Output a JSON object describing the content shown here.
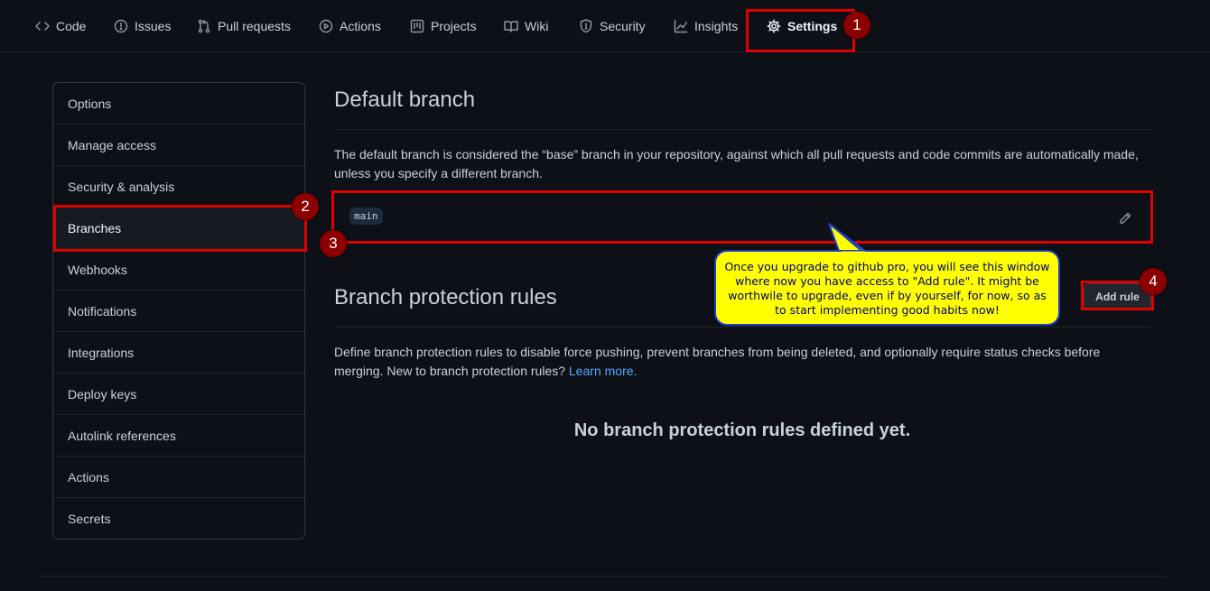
{
  "tabs": [
    {
      "label": "Code",
      "icon": "code-icon"
    },
    {
      "label": "Issues",
      "icon": "issue-icon"
    },
    {
      "label": "Pull requests",
      "icon": "pull-request-icon"
    },
    {
      "label": "Actions",
      "icon": "play-icon"
    },
    {
      "label": "Projects",
      "icon": "project-icon"
    },
    {
      "label": "Wiki",
      "icon": "book-icon"
    },
    {
      "label": "Security",
      "icon": "shield-icon"
    },
    {
      "label": "Insights",
      "icon": "graph-icon"
    },
    {
      "label": "Settings",
      "icon": "gear-icon",
      "active": true
    }
  ],
  "sidebar": {
    "items": [
      {
        "label": "Options"
      },
      {
        "label": "Manage access"
      },
      {
        "label": "Security & analysis"
      },
      {
        "label": "Branches",
        "selected": true
      },
      {
        "label": "Webhooks"
      },
      {
        "label": "Notifications"
      },
      {
        "label": "Integrations"
      },
      {
        "label": "Deploy keys"
      },
      {
        "label": "Autolink references"
      },
      {
        "label": "Actions"
      },
      {
        "label": "Secrets"
      }
    ]
  },
  "default_branch": {
    "title": "Default branch",
    "description": "The default branch is considered the “base” branch in your repository, against which all pull requests and code commits are automatically made, unless you specify a different branch.",
    "branch_name": "main"
  },
  "protection": {
    "title": "Branch protection rules",
    "add_button": "Add rule",
    "description_prefix": "Define branch protection rules to disable force pushing, prevent branches from being deleted, and optionally require status checks before merging. New to branch protection rules? ",
    "learn_more": "Learn more.",
    "empty_message": "No branch protection rules defined yet."
  },
  "annotations": {
    "markers": [
      "1",
      "2",
      "3",
      "4"
    ],
    "callout_text": "Once you upgrade to github pro, you will see this window where now you have access to \"Add rule\". It might be worthwile to upgrade, even if by yourself, for now, so as to start implementing good habits now!"
  },
  "colors": {
    "background": "#0d1117",
    "annotation_red": "#e00000",
    "marker_fill": "#8b0000",
    "callout_fill": "#ffff00",
    "callout_border": "#1d3cc8",
    "link": "#58a6ff"
  }
}
